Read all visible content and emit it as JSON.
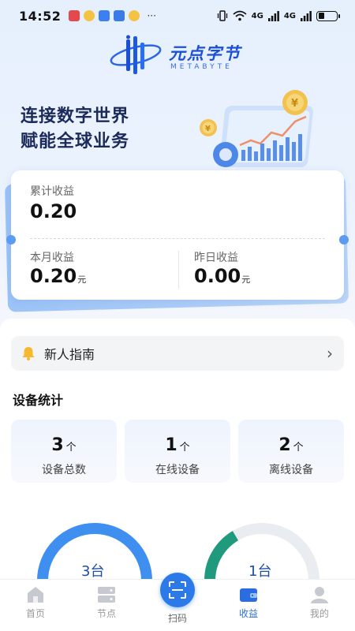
{
  "status_bar": {
    "time": "14:52",
    "signal_1": "4G",
    "signal_2": "4G",
    "battery_level": 0.35,
    "more": "···"
  },
  "logo": {
    "title": "元点字节",
    "subtitle": "METABYTE"
  },
  "slogan": {
    "line1": "连接数字世界",
    "line2": "赋能全球业务"
  },
  "earnings": {
    "total_label": "累计收益",
    "total_value": "0.20",
    "month_label": "本月收益",
    "month_value": "0.20",
    "month_unit": "元",
    "yesterday_label": "昨日收益",
    "yesterday_value": "0.00",
    "yesterday_unit": "元"
  },
  "guide": {
    "label": "新人指南"
  },
  "device_stats": {
    "title": "设备统计",
    "items": [
      {
        "value": "3",
        "unit": "个",
        "label": "设备总数"
      },
      {
        "value": "1",
        "unit": "个",
        "label": "在线设备"
      },
      {
        "value": "2",
        "unit": "个",
        "label": "离线设备"
      }
    ]
  },
  "gauges": [
    {
      "label": "3台",
      "fraction": 1.0,
      "color": "#3f8ff0"
    },
    {
      "label": "1台",
      "fraction": 0.33,
      "color": "#1f9a7c"
    }
  ],
  "tabbar": {
    "tabs": [
      {
        "label": "首页",
        "icon": "home-icon"
      },
      {
        "label": "节点",
        "icon": "server-icon"
      },
      {
        "label": "扫码",
        "icon": "scan-icon"
      },
      {
        "label": "收益",
        "icon": "wallet-icon"
      },
      {
        "label": "我的",
        "icon": "user-icon"
      }
    ],
    "active": "收益"
  },
  "colors": {
    "accent": "#2c79e8",
    "brand": "#1b4fd6",
    "online": "#1f9a7c"
  }
}
